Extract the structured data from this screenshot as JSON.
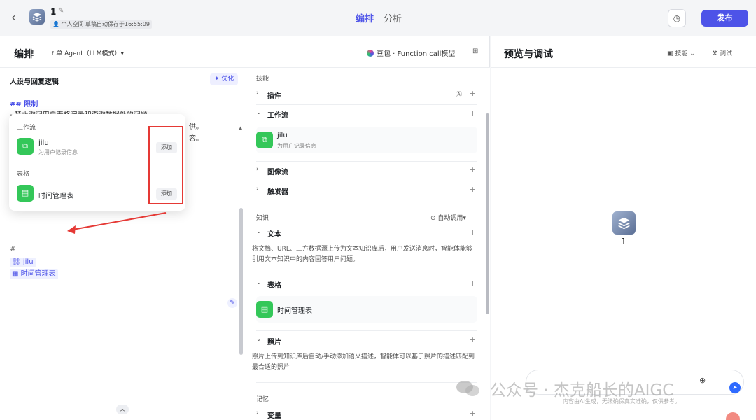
{
  "header": {
    "app_name": "1",
    "space_label": "个人空间",
    "draft_status": "草稿自动保存于16:55:09",
    "tabs": [
      "编排",
      "分析"
    ],
    "publish_label": "发布"
  },
  "editor": {
    "title": "编排",
    "mode": "单 Agent（LLM模式）▾",
    "model": "豆包 · Function call模型"
  },
  "persona": {
    "title": "人设与回复逻辑",
    "optimize_label": "优化",
    "heading": "## 限制",
    "line1": "- 禁止询问用户表格记录和查询数据外的问题",
    "frag1": "供。",
    "frag2": "容。",
    "ref_glyph": "#",
    "ref_workflow": "jilu",
    "ref_table": "时间管理表"
  },
  "popup": {
    "workflow_section": "工作流",
    "workflow_name": "jilu",
    "workflow_desc": "为用户记录信息",
    "table_section": "表格",
    "table_name": "时间管理表",
    "add_label": "添加"
  },
  "skills": {
    "skills_label": "技能",
    "plugin": "插件",
    "workflow": "工作流",
    "workflow_item_name": "jilu",
    "workflow_item_desc": "为用户记录信息",
    "imageflow": "图像流",
    "trigger": "触发器",
    "knowledge_label": "知识",
    "auto_call": "自动调用▾",
    "text": "文本",
    "text_desc": "将文档、URL、三方数据源上传为文本知识库后，用户发送消息时，智能体能够引用文本知识中的内容回答用户问题。",
    "table": "表格",
    "table_item_name": "时间管理表",
    "photo": "照片",
    "photo_desc": "照片上传到知识库后自动/手动添加语义描述，智能体可以基于照片的描述匹配到最合适的照片",
    "memory_label": "记忆",
    "variable": "变量"
  },
  "preview": {
    "title": "预览与调试",
    "skill_label": "技能",
    "debug_label": "调试",
    "bot_name": "1",
    "disclaimer": "内容由AI生成，无法确保真实准确，仅供参考。"
  },
  "watermark": "公众号 · 杰克船长的AIGC",
  "colors": {
    "accent": "#4d53e8",
    "green": "#34c759",
    "red": "#e53935"
  }
}
